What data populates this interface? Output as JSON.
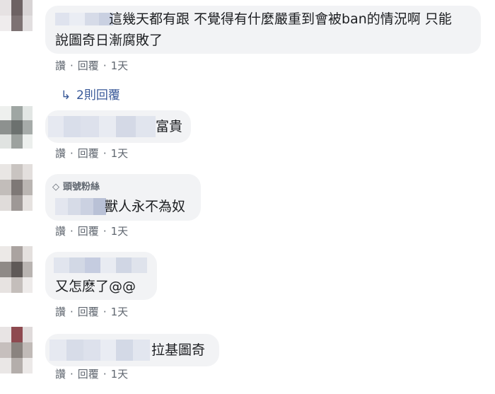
{
  "comments": [
    {
      "text": "這幾天都有跟 不覺得有什麼嚴重到會被ban的情況啊 只能",
      "text_line2": "說圖奇日漸腐敗了",
      "actions": {
        "like": "讚",
        "reply": "回覆",
        "time": "1天"
      }
    },
    {
      "text": "富貴",
      "actions": {
        "like": "讚",
        "reply": "回覆",
        "time": "1天"
      }
    },
    {
      "badge": "頭號粉絲",
      "text": "獸人永不為奴",
      "actions": {
        "like": "讚",
        "reply": "回覆",
        "time": "1天"
      }
    },
    {
      "text": "又怎麽了@@",
      "actions": {
        "like": "讚",
        "reply": "回覆",
        "time": "1天"
      }
    },
    {
      "text": "拉基圖奇",
      "actions": {
        "like": "讚",
        "reply": "回覆",
        "time": "1天"
      }
    }
  ],
  "replies_link": {
    "label": "2則回覆",
    "icon": "reply-arrow-icon"
  },
  "colors": {
    "bubble": "#f2f3f5",
    "link": "#385898",
    "meta": "#606770",
    "text": "#1c1e21"
  }
}
